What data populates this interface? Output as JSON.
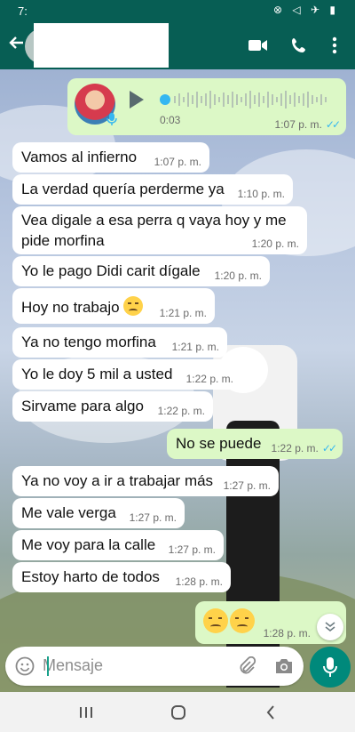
{
  "status_bar": {
    "time": "7:",
    "icons": "⊗ ◁ ✈ ▮"
  },
  "header": {
    "back_icon": "arrow-left-icon",
    "contact_name": "",
    "video_icon": "video-call-icon",
    "call_icon": "phone-icon",
    "menu_icon": "more-vert-icon"
  },
  "voice_note": {
    "duration": "0:03",
    "time": "1:07 p. m.",
    "status": "read"
  },
  "messages": [
    {
      "dir": "in",
      "text": "Vamos al infierno",
      "time": "1:07 p. m."
    },
    {
      "dir": "in",
      "text": "La verdad quería perderme ya",
      "time": "1:10 p. m."
    },
    {
      "dir": "in",
      "text": "Vea digale a esa perra q vaya hoy y me pide morfina",
      "time": "1:20 p. m."
    },
    {
      "dir": "in",
      "text": "Yo le pago Didi carit dígale",
      "time": "1:20 p. m."
    },
    {
      "dir": "in",
      "text": "Hoy no trabajo",
      "time": "1:21 p. m."
    },
    {
      "dir": "in",
      "text": "Ya no tengo morfina",
      "time": "1:21 p. m."
    },
    {
      "dir": "in",
      "text": "Yo le doy 5 mil a usted",
      "time": "1:22 p. m."
    },
    {
      "dir": "in",
      "text": "Sirvame para algo",
      "time": "1:22 p. m."
    },
    {
      "dir": "out",
      "text": "No se puede",
      "time": "1:22 p. m."
    },
    {
      "dir": "in",
      "text": "Ya no voy a ir a trabajar más",
      "time": "1:27 p. m."
    },
    {
      "dir": "in",
      "text": "Me vale verga",
      "time": "1:27 p. m."
    },
    {
      "dir": "in",
      "text": "Me voy para la calle",
      "time": "1:27 p. m."
    },
    {
      "dir": "in",
      "text": "Estoy harto de todos",
      "time": "1:28 p. m."
    },
    {
      "dir": "out",
      "text": "",
      "time": "1:28 p. m."
    }
  ],
  "read_ticks": "✓✓",
  "composer": {
    "placeholder": "Mensaje",
    "emoji_icon": "emoji-icon",
    "attach_icon": "paperclip-icon",
    "camera_icon": "camera-icon",
    "send_icon": "microphone-icon"
  },
  "colors": {
    "header": "#075e54",
    "incoming": "#ffffff",
    "outgoing": "#dcf8c6",
    "accent": "#00897b",
    "ticks": "#34b7f1"
  }
}
